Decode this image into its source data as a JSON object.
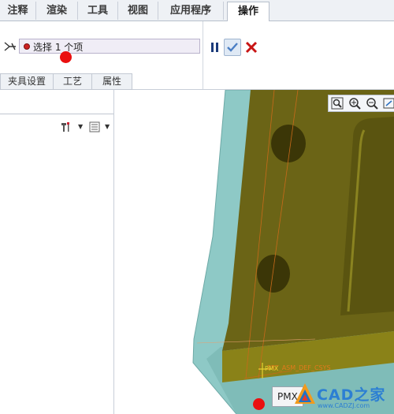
{
  "ribbon_tabs": [
    "注释",
    "渲染",
    "工具",
    "视图",
    "应用程序",
    "操作"
  ],
  "active_tab": "操作",
  "selection": {
    "text": "选择  1  个项"
  },
  "sub_tabs": [
    "夹具设置",
    "工艺",
    "属性"
  ],
  "viewport": {
    "csys_label": "PRT_ASM_DEF_CSYS",
    "marker_label": "PMX",
    "bottom_button": "PMX",
    "watermark": {
      "brand": "CAD之家",
      "url": "www.CADZJ.com"
    }
  },
  "colors": {
    "accent_red": "#ea0f0f",
    "part_body": "#6b6416",
    "fixture": "#8ec9c6"
  }
}
